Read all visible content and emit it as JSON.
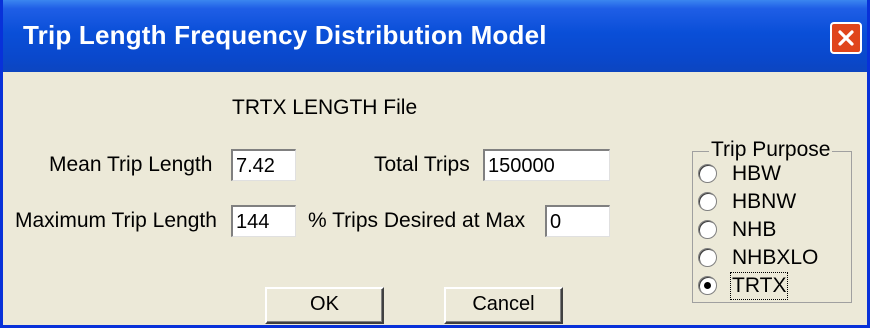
{
  "window": {
    "title": "Trip Length Frequency Distribution Model"
  },
  "heading": "TRTX LENGTH File",
  "fields": {
    "mean_trip_length": {
      "label": "Mean Trip Length",
      "value": "7.42"
    },
    "total_trips": {
      "label": "Total Trips",
      "value": "150000"
    },
    "maximum_trip_length": {
      "label": "Maximum Trip Length",
      "value": "144"
    },
    "pct_trips_desired_at_max": {
      "label": "% Trips Desired at Max",
      "value": "0"
    }
  },
  "trip_purpose": {
    "title": "Trip Purpose",
    "options": [
      {
        "label": "HBW",
        "selected": false
      },
      {
        "label": "HBNW",
        "selected": false
      },
      {
        "label": "NHB",
        "selected": false
      },
      {
        "label": "NHBXLO",
        "selected": false
      },
      {
        "label": "TRTX",
        "selected": true
      }
    ]
  },
  "buttons": {
    "ok": "OK",
    "cancel": "Cancel"
  },
  "colors": {
    "titlebar": "#0a4fd8",
    "close": "#e0451b",
    "dialog_bg": "#ece9d8"
  },
  "icons": {
    "close": "close-icon"
  }
}
